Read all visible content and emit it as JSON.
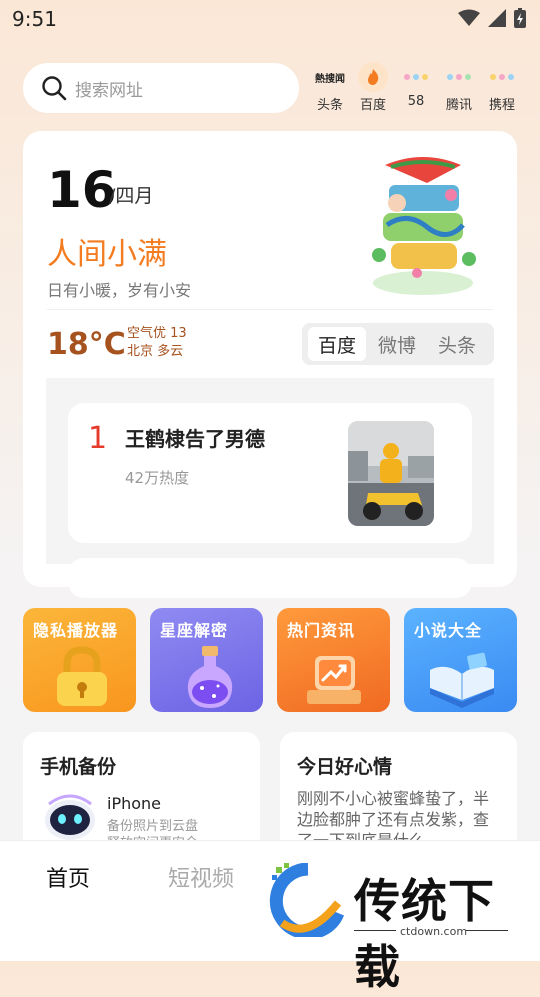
{
  "status": {
    "time": "9:51"
  },
  "search": {
    "placeholder": "搜索网址"
  },
  "quick_links": [
    {
      "label": "头条",
      "icon": "toutiao-icon"
    },
    {
      "label": "百度",
      "icon": "baidu-flame-icon"
    },
    {
      "label": "58",
      "icon": "58-icon"
    },
    {
      "label": "腾讯",
      "icon": "tencent-icon"
    },
    {
      "label": "携程",
      "icon": "ctrip-icon"
    }
  ],
  "quick_icon_text": {
    "toutiao": "熱搜闻"
  },
  "date": {
    "day": "16",
    "month": "/四月",
    "solar_term": "人间小满",
    "motto": "日有小暖，岁有小安"
  },
  "weather": {
    "temp": "18°C",
    "air": "空气优 13",
    "location": "北京 多云"
  },
  "hot_tabs": [
    "百度",
    "微博",
    "头条"
  ],
  "hot_item": {
    "rank": "1",
    "title": "王鹤棣告了男德",
    "heat": "42万热度"
  },
  "tiles": [
    {
      "label": "隐私播放器"
    },
    {
      "label": "星座解密"
    },
    {
      "label": "热门资讯"
    },
    {
      "label": "小说大全"
    }
  ],
  "backup": {
    "title": "手机备份",
    "device": "iPhone",
    "desc": "备份照片到云盘",
    "desc2": "释放空间更安全"
  },
  "mood": {
    "title": "今日好心情",
    "text": "刚刚不小心被蜜蜂蛰了，半边脸都肿了还有点发紫，查了一下到底是什么"
  },
  "bottom_tabs": {
    "home": "首页",
    "video": "短视频"
  },
  "watermark": {
    "brand": "传统下载",
    "url": "ctdown.com"
  },
  "colors": {
    "accent": "#f47c20",
    "temp": "#a6521e",
    "rank": "#e53b2c"
  }
}
